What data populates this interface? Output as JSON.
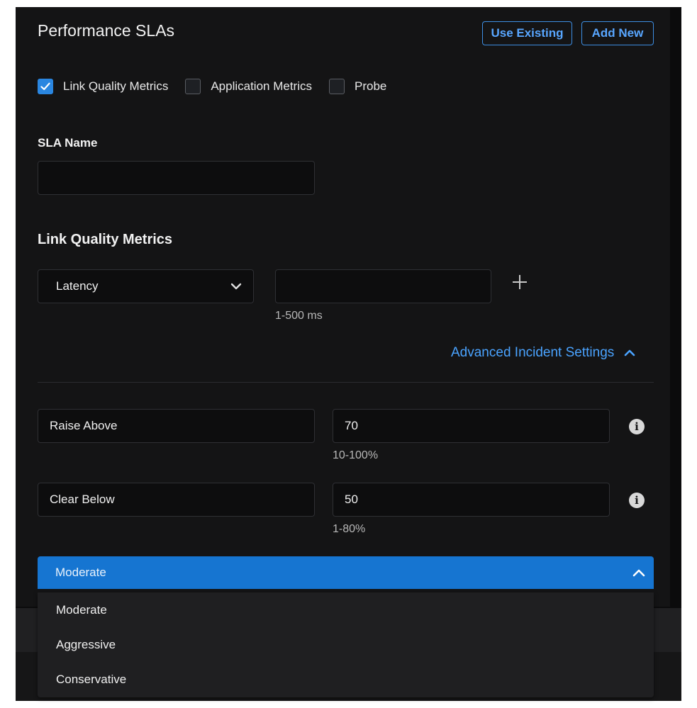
{
  "header": {
    "title": "Performance SLAs",
    "use_existing_label": "Use Existing",
    "add_new_label": "Add New"
  },
  "metric_types": [
    {
      "label": "Link Quality Metrics",
      "checked": true
    },
    {
      "label": "Application Metrics",
      "checked": false
    },
    {
      "label": "Probe",
      "checked": false
    }
  ],
  "sla_name": {
    "label": "SLA Name",
    "value": ""
  },
  "link_quality": {
    "heading": "Link Quality Metrics",
    "metric_selected": "Latency",
    "threshold_value": "",
    "threshold_hint": "1-500 ms",
    "add_icon": "plus-icon"
  },
  "advanced": {
    "toggle_label": "Advanced Incident Settings",
    "expanded": true,
    "raise": {
      "label": "Raise Above",
      "value": "70",
      "hint": "10-100%"
    },
    "clear": {
      "label": "Clear Below",
      "value": "50",
      "hint": "1-80%"
    },
    "mode_selected": "Moderate",
    "mode_options": [
      "Moderate",
      "Aggressive",
      "Conservative"
    ]
  },
  "colors": {
    "accent": "#1675d1",
    "link": "#4aa3ff",
    "checkbox_checked": "#2a86e0",
    "background": "#141415"
  }
}
